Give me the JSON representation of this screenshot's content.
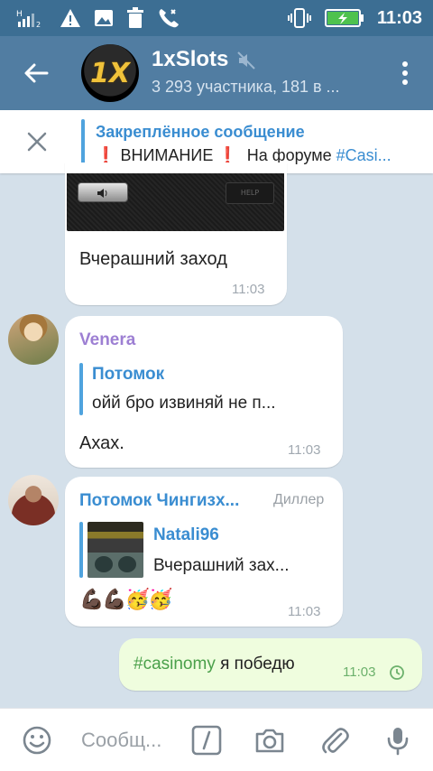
{
  "status_bar": {
    "time": "11:03",
    "left_icons": [
      "signal-icon",
      "warning-icon",
      "image-icon",
      "trash-icon",
      "call-icon"
    ],
    "right_icons": [
      "vibrate-icon",
      "battery-charging-icon"
    ]
  },
  "header": {
    "title": "1xSlots",
    "subtitle": "3 293 участника, 181 в ...",
    "avatar_text": "1X",
    "icons": [
      "back-arrow-icon",
      "mute-icon",
      "more-vert-icon"
    ]
  },
  "pinned": {
    "title": "Закреплённое сообщение",
    "text_before": "ВНИМАНИЕ",
    "text_after": "На форуме",
    "hashtag": "#Casi...",
    "exclaim": "❗"
  },
  "messages": [
    {
      "id": "m1",
      "media_label": "HELP",
      "text": "Вчерашний заход",
      "time": "11:03"
    },
    {
      "id": "m2",
      "sender": "Venera",
      "sender_color": "#9d7fd3",
      "reply_name": "Потомок",
      "reply_text": "ойй  бро извиняй не п...",
      "text": "Ахах.",
      "time": "11:03"
    },
    {
      "id": "m3",
      "sender": "Потомок Чингизх...",
      "badge": "Диллер",
      "sender_color": "#3a8dd1",
      "reply_name": "Natali96",
      "reply_text": "Вчерашний зах...",
      "text": "💪🏿💪🏿🥳🥳",
      "time": "11:03"
    },
    {
      "id": "m4",
      "hashtag": "#casinomy",
      "text": "я победю",
      "time": "11:03",
      "outgoing": true
    }
  ],
  "input": {
    "placeholder": "Сообщ...",
    "icons": [
      "emoji-icon",
      "bot-command-icon",
      "camera-icon",
      "attach-icon",
      "mic-icon"
    ]
  },
  "colors": {
    "status_bar": "#3c6e93",
    "header": "#517da2",
    "background": "#d4e0ea",
    "accent": "#3a8dd1",
    "outgoing_bubble": "#effdde",
    "outgoing_text_tag": "#4aa04a"
  }
}
